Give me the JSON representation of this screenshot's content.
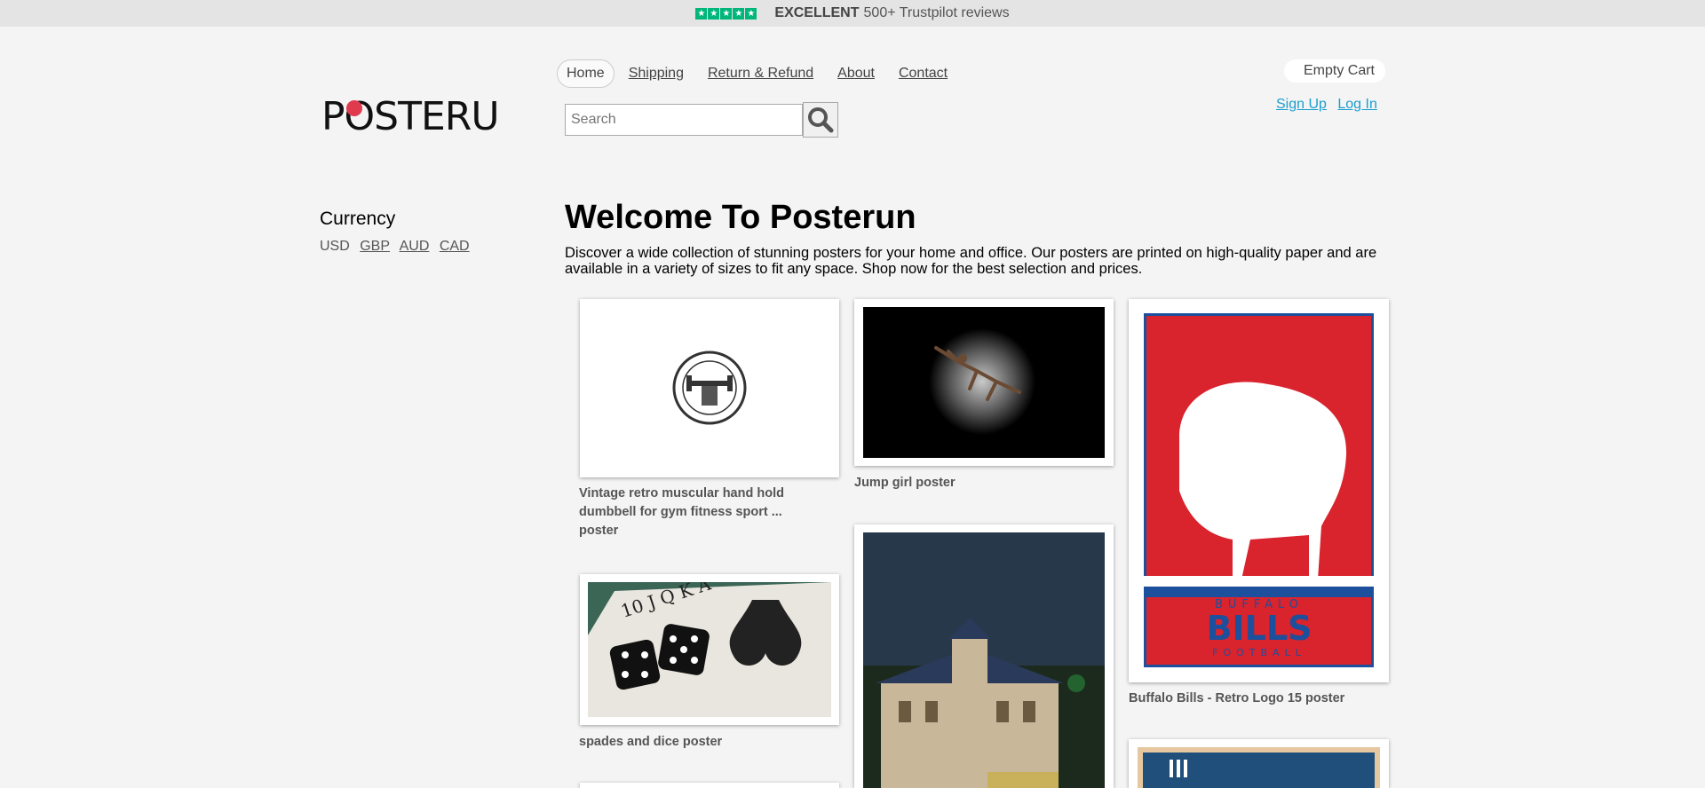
{
  "topbar": {
    "rating": "EXCELLENT",
    "reviews": "500+ Trustpilot reviews"
  },
  "logo": {
    "text": "POSTERUN"
  },
  "nav": {
    "home": "Home",
    "shipping": "Shipping",
    "refund": "Return & Refund",
    "about": "About",
    "contact": "Contact"
  },
  "search": {
    "placeholder": "Search"
  },
  "cart": {
    "label": "Empty Cart"
  },
  "auth": {
    "signup": "Sign Up",
    "login": "Log In"
  },
  "currency": {
    "title": "Currency",
    "selected": "USD",
    "options": [
      "GBP",
      "AUD",
      "CAD"
    ]
  },
  "welcome": {
    "title": "Welcome To Posterun",
    "description": "Discover a wide collection of stunning posters for your home and office. Our posters are printed on high-quality paper and are available in a variety of sizes to fit any space. Shop now for the best selection and prices."
  },
  "products": [
    {
      "title": "Vintage retro muscular hand hold dumbbell for gym fitness sport ... poster"
    },
    {
      "title": "Jump girl poster"
    },
    {
      "title": "Buffalo Bills - Retro Logo 15 poster",
      "poster_text_top": "BUFFALO",
      "poster_text_main": "BILLS",
      "poster_text_bottom": "FOOTBALL"
    },
    {
      "title": "spades and dice poster",
      "card_text": "10 J Q K A"
    },
    {
      "title": ""
    },
    {
      "title": ""
    }
  ],
  "colors": {
    "accent": "#1a9fcf",
    "trustpilot": "#00b67a",
    "bills_red": "#d9232d",
    "bills_blue": "#1c4f9c"
  }
}
